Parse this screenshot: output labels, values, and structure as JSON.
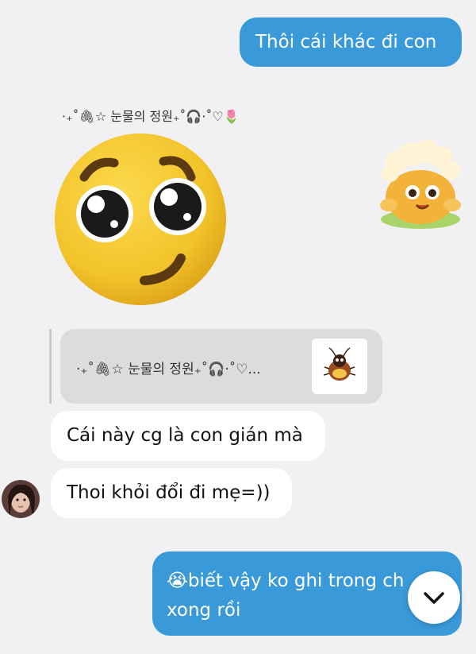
{
  "messages": {
    "out_1": "Thôi cái khác đi con",
    "in_1": "Cái này cg là con gián mà",
    "in_2": "Thoi khỏi đổi đi mẹ=))",
    "out_2_emoji": "😭",
    "out_2_line1": "biết vậy ko ghi trong ch",
    "out_2_line2": "xong rồi"
  },
  "sender": {
    "name": "·₊˚🖇☆ 눈물의 정원₊˚🎧·˚♡🌷"
  },
  "reply": {
    "quoted_name": "·₊˚🖇☆ 눈물의 정원₊˚🎧·˚♡..."
  },
  "icons": {
    "scroll_down": "chevron-down-icon"
  },
  "colors": {
    "outgoing": "#3a9ad9",
    "incoming": "#ffffff",
    "background": "#f1f1f3"
  }
}
